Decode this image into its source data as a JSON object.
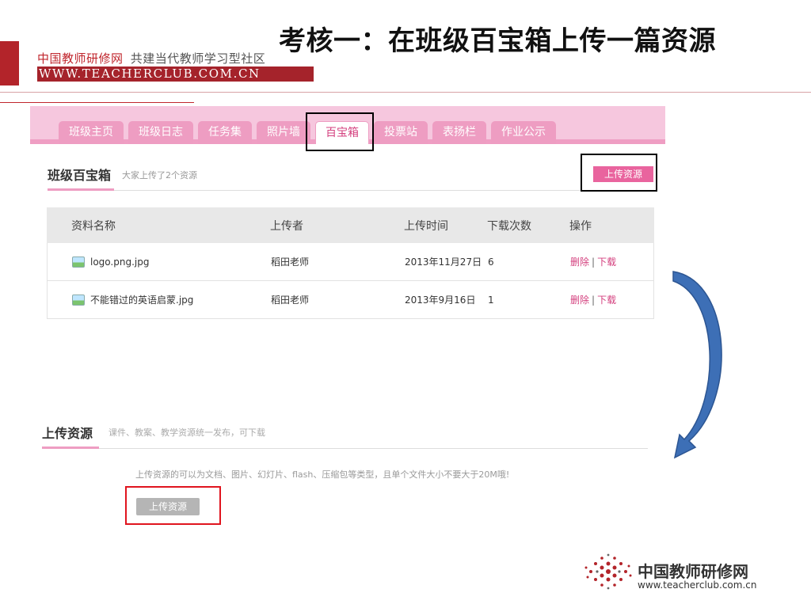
{
  "slide": {
    "title": "考核一：在班级百宝箱上传一篇资源"
  },
  "brand": {
    "name_cn": "中国教师研修网",
    "slogan": "共建当代教师学习型社区",
    "url_upper": "WWW.TEACHERCLUB.COM.CN"
  },
  "tabs": [
    "班级主页",
    "班级日志",
    "任务集",
    "照片墙",
    "百宝箱",
    "投票站",
    "表扬栏",
    "作业公示"
  ],
  "active_tab": "百宝箱",
  "treasure": {
    "title": "班级百宝箱",
    "subtitle": "大家上传了2个资源",
    "upload_button": "上传资源"
  },
  "table": {
    "headers": [
      "资料名称",
      "上传者",
      "上传时间",
      "下载次数",
      "操作"
    ],
    "rows": [
      {
        "name": "logo.png.jpg",
        "uploader": "稻田老师",
        "time": "2013年11月27日",
        "downloads": "6",
        "delete": "删除",
        "download": "下载"
      },
      {
        "name": "不能错过的英语启蒙.jpg",
        "uploader": "稻田老师",
        "time": "2013年9月16日",
        "downloads": "1",
        "delete": "删除",
        "download": "下载"
      }
    ]
  },
  "upload_section": {
    "title": "上传资源",
    "subtitle": "课件、教案、教学资源统一发布，可下载",
    "note": "上传资源的可以为文档、图片、幻灯片、flash、压缩包等类型，且单个文件大小不要大于20M哦!",
    "button": "上传资源"
  },
  "footer_logo": {
    "name_cn": "中国教师研修网",
    "url": "www.teacherclub.com.cn"
  },
  "colors": {
    "brand_red": "#b3242a",
    "tab_pink": "#ee9dc2",
    "accent_pink": "#e9649e",
    "arrow_blue": "#3d6fb6",
    "highlight_red": "#e0141e"
  }
}
